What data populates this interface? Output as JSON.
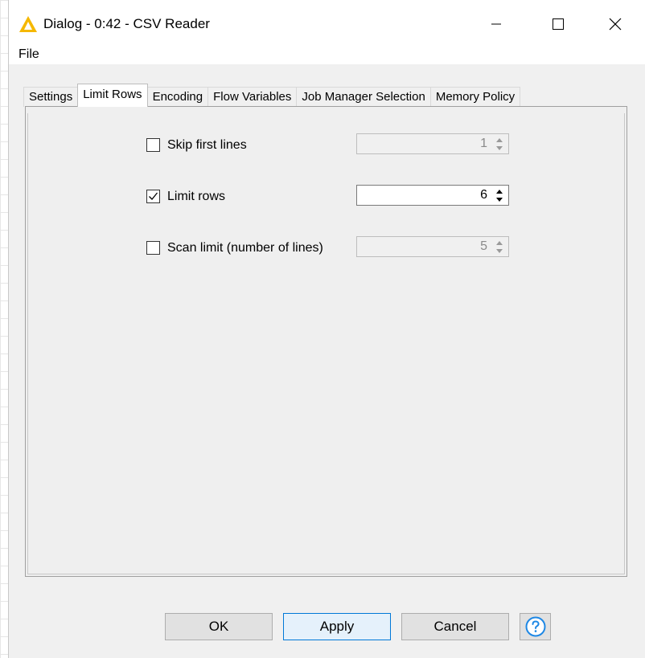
{
  "window": {
    "title": "Dialog - 0:42 - CSV Reader",
    "icon": "knime-triangle-icon",
    "controls": [
      "minimize-icon",
      "maximize-icon",
      "close-icon"
    ]
  },
  "menu": {
    "file": "File"
  },
  "tabs": [
    {
      "label": "Settings",
      "active": false
    },
    {
      "label": "Limit Rows",
      "active": true
    },
    {
      "label": "Encoding",
      "active": false
    },
    {
      "label": "Flow Variables",
      "active": false
    },
    {
      "label": "Job Manager Selection",
      "active": false
    },
    {
      "label": "Memory Policy",
      "active": false
    }
  ],
  "limit_rows": {
    "skip_first_lines": {
      "label": "Skip first lines",
      "checked": false,
      "value": "1",
      "enabled": false
    },
    "limit_rows": {
      "label": "Limit rows",
      "checked": true,
      "value": "6",
      "enabled": true
    },
    "scan_limit": {
      "label": "Scan limit (number of lines)",
      "checked": false,
      "value": "5",
      "enabled": false
    }
  },
  "buttons": {
    "ok": "OK",
    "apply": "Apply",
    "cancel": "Cancel",
    "help_icon": "help-question-icon"
  },
  "colors": {
    "default_button_border": "#0078d7",
    "help_icon": "#1e88e5",
    "logo": "#f5b800"
  }
}
